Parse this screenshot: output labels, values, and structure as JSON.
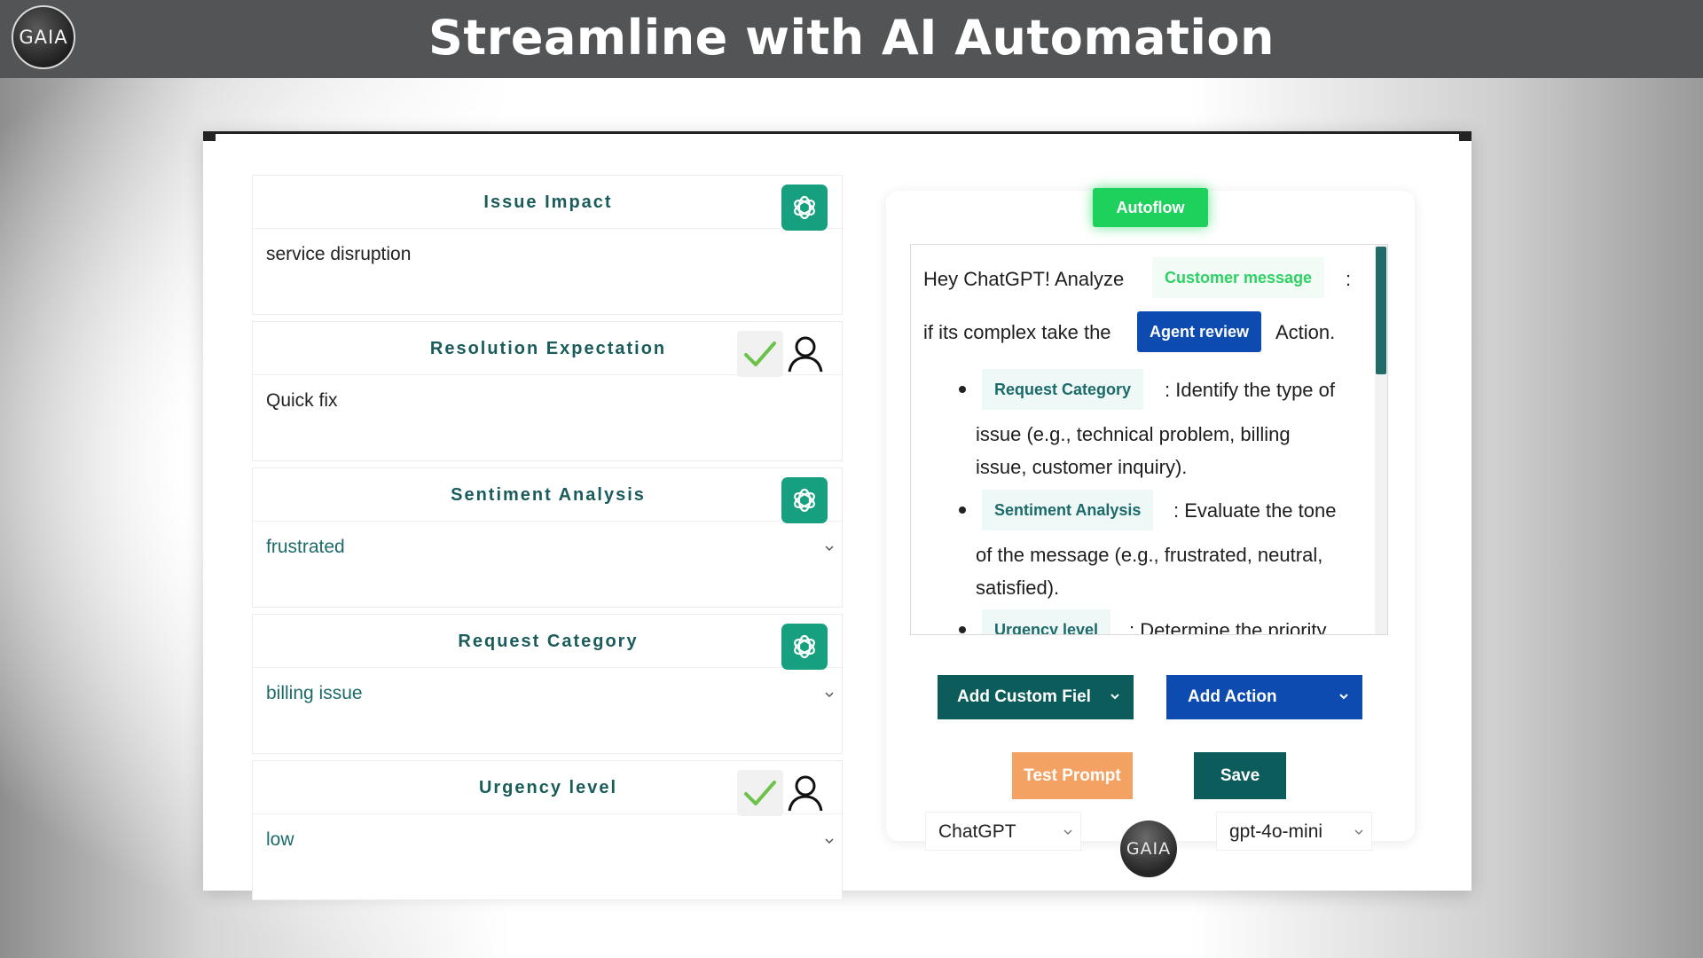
{
  "header": {
    "logo_text": "GAIA",
    "title": "Streamline with AI Automation"
  },
  "colors": {
    "header_bg": "#535456",
    "teal": "#0d5c5c",
    "label_teal": "#1a5b5b",
    "openai_green": "#17a07f",
    "autoflow_green": "#1ed15d",
    "blue": "#0d4bb0",
    "orange": "#f4a264"
  },
  "fields": [
    {
      "label": "Issue Impact",
      "value": "service disruption",
      "control": "openai-icon",
      "type": "text"
    },
    {
      "label": "Resolution Expectation",
      "value": "Quick fix",
      "control": "approve-check-and-person",
      "type": "text"
    },
    {
      "label": "Sentiment Analysis",
      "value": "frustrated",
      "control": "openai-icon",
      "type": "select"
    },
    {
      "label": "Request Category",
      "value": "billing issue",
      "control": "openai-icon",
      "type": "select"
    },
    {
      "label": "Urgency level",
      "value": "low",
      "control": "approve-check-and-person",
      "type": "select"
    }
  ],
  "panel": {
    "autoflow_label": "Autoflow",
    "prompt": {
      "intro": "Hey ChatGPT!  Analyze",
      "customer_message_chip": "Customer message",
      "colon": ":",
      "line2_start": "if its complex take the",
      "agent_review_chip": "Agent review",
      "line2_end": "Action.",
      "bullets": [
        {
          "chip": "Request Category",
          "text_lines": [
            ": Identify the type of",
            "issue (e.g., technical problem, billing",
            "issue, customer inquiry)."
          ]
        },
        {
          "chip": "Sentiment Analysis",
          "text_lines": [
            ": Evaluate the tone",
            "of the message (e.g., frustrated, neutral,",
            "satisfied)."
          ]
        },
        {
          "chip": "Urgency level",
          "text_lines": [
            ": Determine the priority"
          ]
        }
      ]
    },
    "add_custom_field_label": "Add Custom Fiel",
    "add_action_label": "Add Action",
    "test_prompt_label": "Test Prompt",
    "save_label": "Save",
    "model_select": "ChatGPT",
    "model_version_select": "gpt-4o-mini",
    "bubble_logo_text": "GAIA"
  }
}
